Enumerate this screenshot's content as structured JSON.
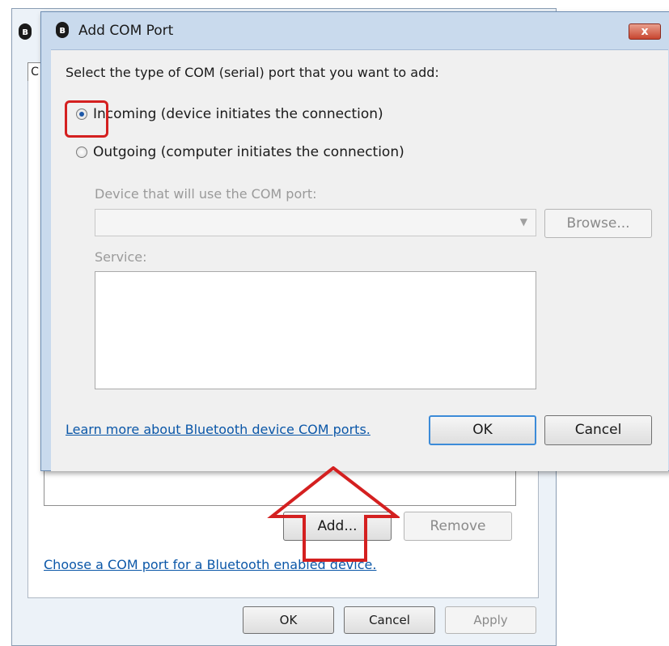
{
  "background_window": {
    "tab_letter": "C",
    "add_button": "Add...",
    "remove_button": "Remove",
    "link": "Choose a COM port for a Bluetooth enabled device.",
    "ok_button": "OK",
    "cancel_button": "Cancel",
    "apply_button": "Apply"
  },
  "dialog": {
    "title": "Add COM Port",
    "close_label": "x",
    "prompt": "Select the type of COM (serial) port that you want to add:",
    "radio_incoming": "Incoming (device initiates the connection)",
    "radio_outgoing": "Outgoing (computer initiates the connection)",
    "selected_radio": "incoming",
    "device_label": "Device that will use the COM port:",
    "device_value": "",
    "browse_button": "Browse...",
    "service_label": "Service:",
    "learn_more_link": "Learn more about Bluetooth device COM ports.",
    "ok_button": "OK",
    "cancel_button": "Cancel"
  },
  "colors": {
    "annotation": "#d42020",
    "link": "#0b57a8",
    "default_button_border": "#3c8bd8"
  },
  "icons": {
    "app": "bluetooth-icon",
    "dropdown": "chevron-down-icon"
  }
}
